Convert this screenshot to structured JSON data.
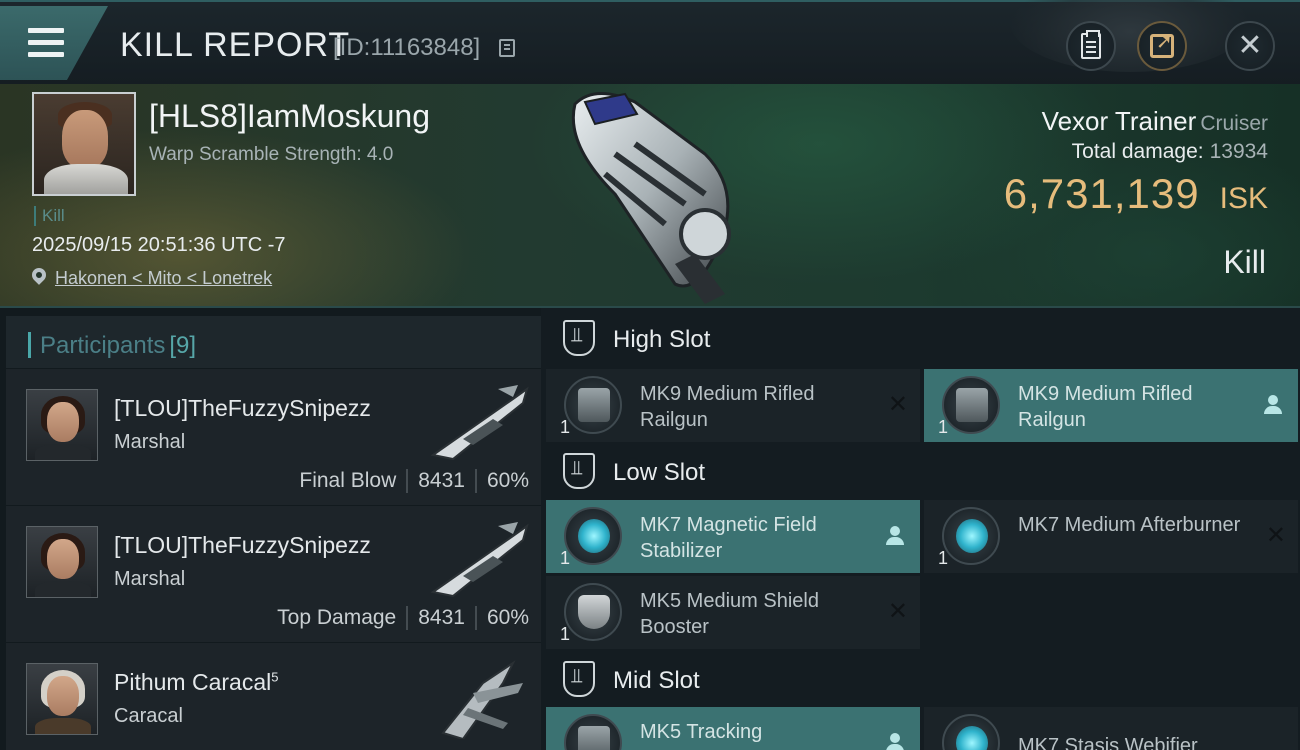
{
  "header": {
    "title": "KILL REPORT",
    "report_id": "[ID:11163848]"
  },
  "victim": {
    "name": "[HLS8]IamMoskung",
    "warp_scramble": "Warp Scramble Strength: 4.0",
    "kill_tag": "Kill",
    "time": "2025/09/15 20:51:36 UTC -7",
    "location": "Hakonen < Mito < Lonetrek",
    "ship_name": "Vexor Trainer",
    "ship_class": "Cruiser",
    "damage_label": "Total damage:",
    "damage_value": "13934",
    "isk_value": "6,731,139",
    "isk_unit": "ISK",
    "result": "Kill"
  },
  "participants": {
    "title": "Participants",
    "count": "[9]",
    "list": [
      {
        "name": "[TLOU]TheFuzzySnipezz",
        "ship": "Marshal",
        "role": "Final Blow",
        "damage": "8431",
        "percent": "60%"
      },
      {
        "name": "[TLOU]TheFuzzySnipezz",
        "ship": "Marshal",
        "role": "Top Damage",
        "damage": "8431",
        "percent": "60%"
      },
      {
        "name": "Pithum Caracal",
        "name_sup": "5",
        "ship": "Caracal"
      }
    ]
  },
  "slots": {
    "high": {
      "title": "High Slot",
      "modules": [
        {
          "name": "MK9 Medium Rifled Railgun",
          "qty": "1",
          "status": "✕"
        },
        {
          "name": "MK9 Medium Rifled Railgun",
          "qty": "1"
        }
      ]
    },
    "low": {
      "title": "Low Slot",
      "modules": [
        {
          "name": "MK7 Magnetic Field Stabilizer",
          "qty": "1"
        },
        {
          "name": "MK7 Medium Afterburner",
          "qty": "1",
          "status": "✕"
        },
        {
          "name": "MK5 Medium Shield Booster",
          "qty": "1",
          "status": "✕"
        }
      ]
    },
    "mid": {
      "title": "Mid Slot",
      "modules": [
        {
          "name": "MK5 Tracking"
        },
        {
          "name": "MK7 Stasis Webifier"
        }
      ]
    }
  },
  "icons": {
    "menu": "menu-icon",
    "copy": "copy-icon",
    "clipboard": "clipboard-icon",
    "share": "share-icon",
    "close": "close-icon",
    "location": "location-pin-icon",
    "slot": "slot-shield-icon",
    "pilot": "pilot-icon"
  },
  "colors": {
    "accent": "#3b7272",
    "isk": "#e6bc7c",
    "participants_title": "#4b7f87"
  }
}
